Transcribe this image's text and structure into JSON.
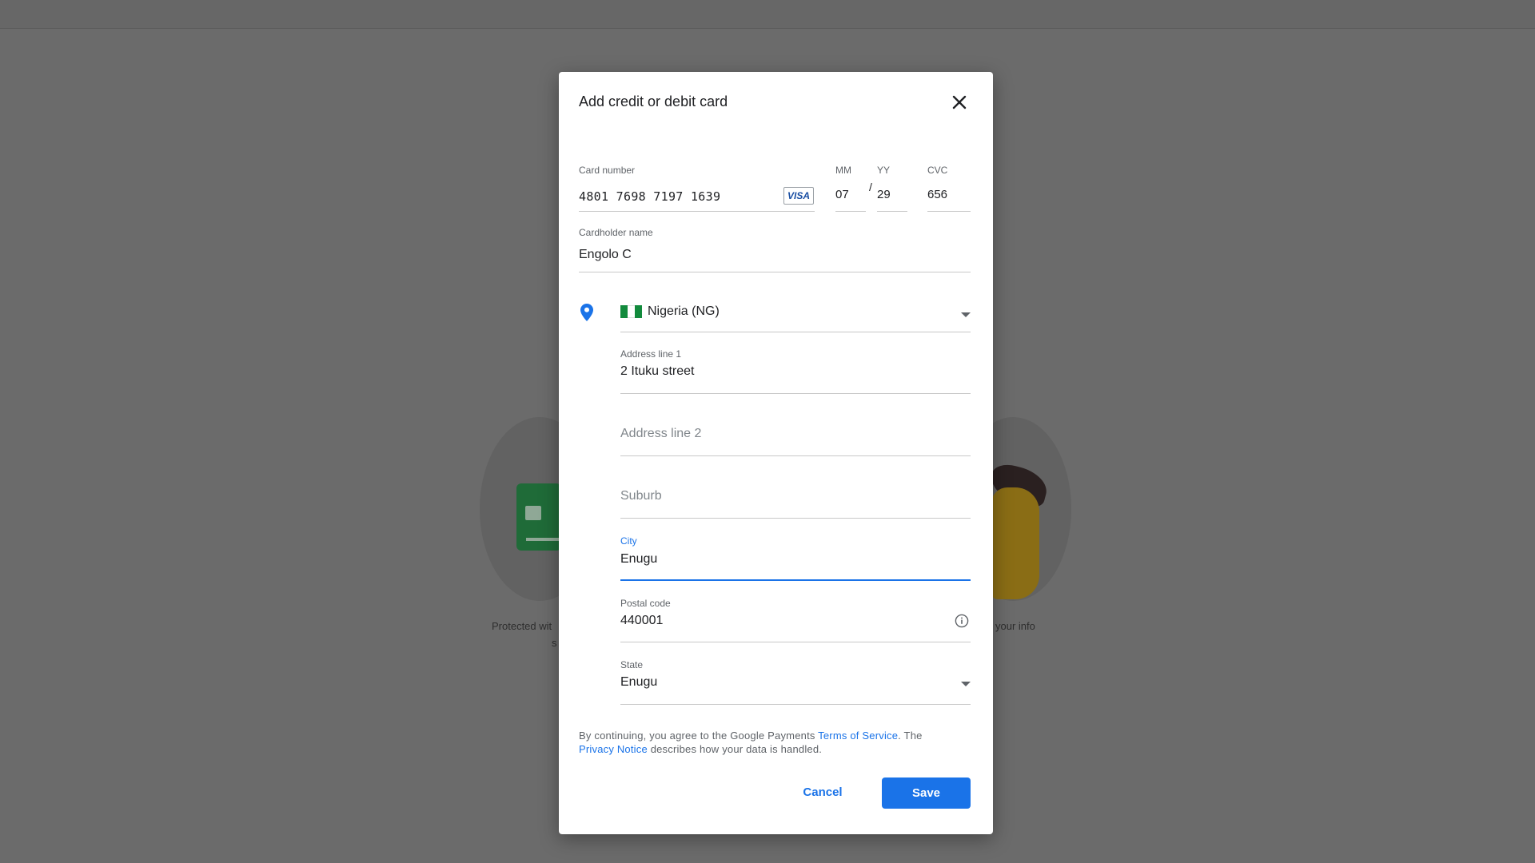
{
  "background": {
    "left_caption": "Protected wit",
    "left_caption_2": "s",
    "right_caption": "your info"
  },
  "dialog": {
    "title": "Add credit or debit card",
    "close_icon": "close-icon"
  },
  "card": {
    "number_label": "Card number",
    "number_value": "4801 7698 7197 1639",
    "brand": "VISA",
    "month_label": "MM",
    "month_value": "07",
    "separator": "/",
    "year_label": "YY",
    "year_value": "29",
    "cvc_label": "CVC",
    "cvc_value": "656"
  },
  "cardholder": {
    "label": "Cardholder name",
    "value": "Engolo C"
  },
  "address": {
    "location_icon": "location-pin-icon",
    "country": "Nigeria (NG)",
    "line1_label": "Address line 1",
    "line1_value": "2 Ituku street",
    "line2_placeholder": "Address line 2",
    "suburb_placeholder": "Suburb",
    "city_label": "City",
    "city_value": "Enugu",
    "postal_label": "Postal code",
    "postal_value": "440001",
    "state_label": "State",
    "state_value": "Enugu"
  },
  "legal": {
    "part1": "By continuing, you agree to the Google Payments ",
    "terms_link": "Terms of Service",
    "part2": ". The ",
    "privacy_link": "Privacy Notice",
    "part3": " describes how your data is handled."
  },
  "actions": {
    "cancel_label": "Cancel",
    "save_label": "Save"
  },
  "colors": {
    "accent": "#1a73e8",
    "overlay": "#6b6b6b",
    "flag_green": "#128a3c"
  }
}
